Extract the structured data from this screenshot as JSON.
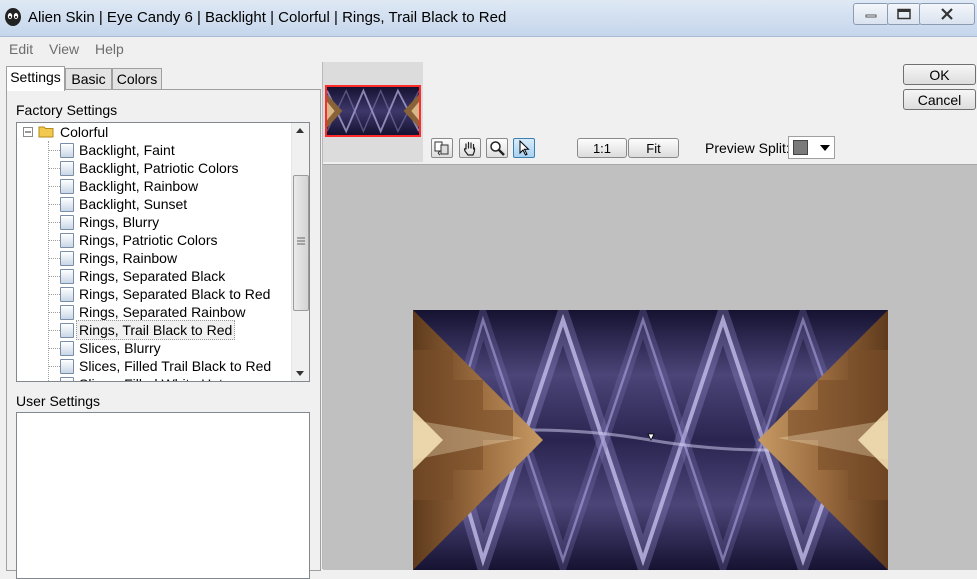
{
  "window": {
    "title": "Alien Skin | Eye Candy 6 | Backlight | Colorful | Rings, Trail Black to Red",
    "icon": "alien-skin-icon"
  },
  "menu": [
    "Edit",
    "View",
    "Help"
  ],
  "tabs": [
    "Settings",
    "Basic",
    "Colors"
  ],
  "active_tab": "Settings",
  "factory_settings": {
    "label": "Factory Settings",
    "folder": "Colorful",
    "items": [
      "Backlight, Faint",
      "Backlight, Patriotic Colors",
      "Backlight, Rainbow",
      "Backlight, Sunset",
      "Rings, Blurry",
      "Rings, Patriotic Colors",
      "Rings, Rainbow",
      "Rings, Separated Black",
      "Rings, Separated Black to Red",
      "Rings, Separated Rainbow",
      "Rings, Trail Black to Red",
      "Slices, Blurry",
      "Slices, Filled Trail Black to Red",
      "Slices, Filled White Hot"
    ],
    "selected": "Rings, Trail Black to Red"
  },
  "user_settings": {
    "label": "User Settings"
  },
  "toolbar": {
    "tools": [
      "compare-icon",
      "hand-icon",
      "zoom-icon",
      "arrow-pointer-icon"
    ],
    "active_tool": "arrow-pointer-icon",
    "zoom_1to1": "1:1",
    "zoom_fit": "Fit",
    "preview_split_label": "Preview Split:"
  },
  "buttons": {
    "ok": "OK",
    "cancel": "Cancel"
  },
  "colors": {
    "title_bar": "#d3e0f0",
    "preview_bg": "#c0c0c0",
    "thumb_border": "#ff2a2a",
    "rings_purple": "#6b6497",
    "rings_dark": "#151231"
  }
}
